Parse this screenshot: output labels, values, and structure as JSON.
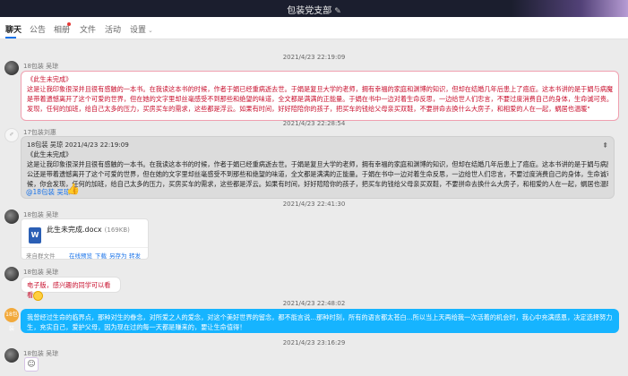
{
  "window": {
    "title": "包装党支部"
  },
  "tabs": [
    {
      "label": "聊天"
    },
    {
      "label": "公告"
    },
    {
      "label": "相册"
    },
    {
      "label": "文件"
    },
    {
      "label": "活动"
    },
    {
      "label": "设置"
    }
  ],
  "messages": {
    "ts1": "2021/4/23 22:19:09",
    "m1": {
      "sender": "18包装 吴琼",
      "title": "《此生未完成》",
      "line1": "这是让我印象很深并且很有感触的一本书。在我读这本书的时候，作者于娟已经重病逝去世。于娟是复旦大学的老师，拥有幸福的家庭和渊博的知识，但却在结婚几年后患上了癌症。这本书讲的是于娟与病魔斗争的事，尽管最后主人公还",
      "line2": "是带着遗憾离开了这个可爱的世界，但在她的文字里却丝毫感受不到那些和绝望的味道，全文都是满满的正能量。于娟在书中一边对着生命反思，一边给世人们忠言，不要过度消费自己的身体，生命诚可贵。 \"在生命临界点的时候，你会",
      "line3": "发现，任何的加班，给自己太多的压力，买房买车的需求，这些都是浮云。如果有时间，好好陪陪你的孩子，把买车的钱给父母亲买双鞋，不要拼命去换什么大房子，和相爱的人在一起，蜗居也温暖\""
    },
    "ts2": "2021/4/23 22:28:54",
    "m2": {
      "sender": "17包装刘惠",
      "quote_head": "18包装 吴琼 2021/4/23 22:19:09",
      "title": "《此生未完成》",
      "line1": "这是让我印象很深并且很有感触的一本书。在我读这本书的时候，作者于娟已经重病逝去世。于娟是复旦大学的老师，拥有幸福的家庭和渊博的知识，但却在结婚几年后患上了癌症。这本书讲的是于娟与病魔斗争的事，尽管最后主人",
      "line2": "公还是带着遗憾离开了这个可爱的世界，但在她的文字里却丝毫感受不到那些和绝望的味道，全文都是满满的正能量。于娟在书中一边对着生命反思，一边给世人们忠言，不要过度消费自己的身体，生命诚可贵。 \"在生命临界点的时",
      "line3": "候，你会发现，任何的加班，给自己太多的压力，买房买车的需求，这些都是浮云。如果有时间，好好陪陪你的孩子，把买车的钱给父母亲买双鞋，不要拼命去换什么大房子，和相爱的人在一起，蜗居也温暖\"",
      "mention": "@18包装 吴琼"
    },
    "ts3": "2021/4/23 22:41:30",
    "m3": {
      "sender": "18包装 吴琼",
      "file_name": "此生未完成.docx",
      "file_size": "(169KB)",
      "source": "来自群文件",
      "actions": [
        "在线预览",
        "下载",
        "另存为",
        "转发"
      ]
    },
    "m4": {
      "sender": "18包装 吴琼",
      "text": "电子版，感兴趣的同学可以看看"
    },
    "ts4": "2021/4/23 22:48:02",
    "m5": {
      "sender": "18包装",
      "avatar": "18包装",
      "line1": "我曾经过生命的临界点，那种对生的眷念，对所爱之人的爱念，对这个美好世界的留念，都不能言说...那种时刻，所有的语言都太苍白...所以当上天再给我一次活着的机会时，我心中充满感恩，决定选择努力工作，好好养育孩子，教育学",
      "line2": "生，充实自己，爱护父母，因为现在过的每一天都是赚来的，要让生命值得！"
    },
    "ts5": "2021/4/23 23:16:29",
    "m6": {
      "sender": "18包装 吴琼"
    }
  },
  "colors": {
    "accent": "#1a73e8",
    "red_text": "#c8102e",
    "blue_bubble": "#16b4ff"
  }
}
